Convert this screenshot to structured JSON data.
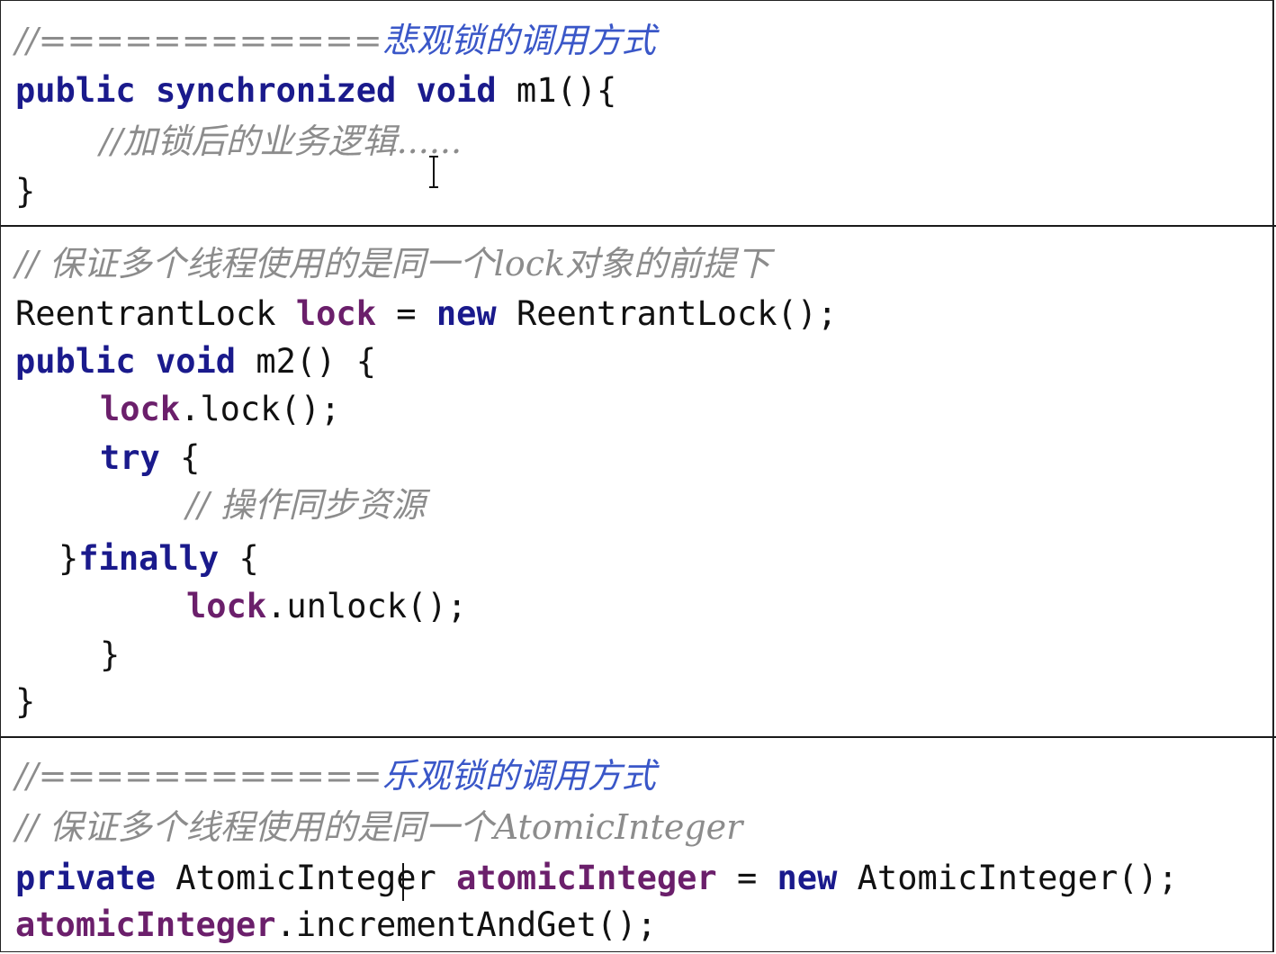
{
  "section_pessimistic": {
    "header_prefix": "//============",
    "header_title": "悲观锁的调用方式",
    "m1": {
      "kw_public": "public",
      "kw_synchronized": "synchronized",
      "kw_void": "void",
      "signature": "m1(){",
      "body_comment": "//加锁后的业务逻辑......",
      "close": "}"
    }
  },
  "section_lock": {
    "comment": "// 保证多个线程使用的是同一个lock对象的前提下",
    "decl": {
      "type": "ReentrantLock",
      "field": "lock",
      "eq": "=",
      "kw_new": "new",
      "ctor": "ReentrantLock();"
    },
    "m2": {
      "kw_public": "public",
      "kw_void": "void",
      "signature": "m2() {",
      "lock_field": "lock",
      "lock_call": ".lock();",
      "kw_try": "try",
      "try_open": "{",
      "sync_comment": "// 操作同步资源",
      "finally_close": "}",
      "kw_finally": "finally",
      "finally_open": "{",
      "unlock_field": "lock",
      "unlock_call": ".unlock();",
      "inner_close": "}",
      "outer_close": "}"
    }
  },
  "section_optimistic": {
    "header_prefix": "//============",
    "header_title": "乐观锁的调用方式",
    "comment": "// 保证多个线程使用的是同一个AtomicInteger",
    "decl": {
      "kw_private": "private",
      "type": "AtomicInteger",
      "field": "atomicInteger",
      "eq": "=",
      "kw_new": "new",
      "ctor": "AtomicInteger();"
    },
    "call": {
      "field": "atomicInteger",
      "method": ".incrementAndGet();"
    }
  },
  "colors": {
    "keyword": "#1a1a8c",
    "field": "#6b1f6b",
    "comment": "#8c8c8c",
    "header_comment": "#3a57c8"
  }
}
